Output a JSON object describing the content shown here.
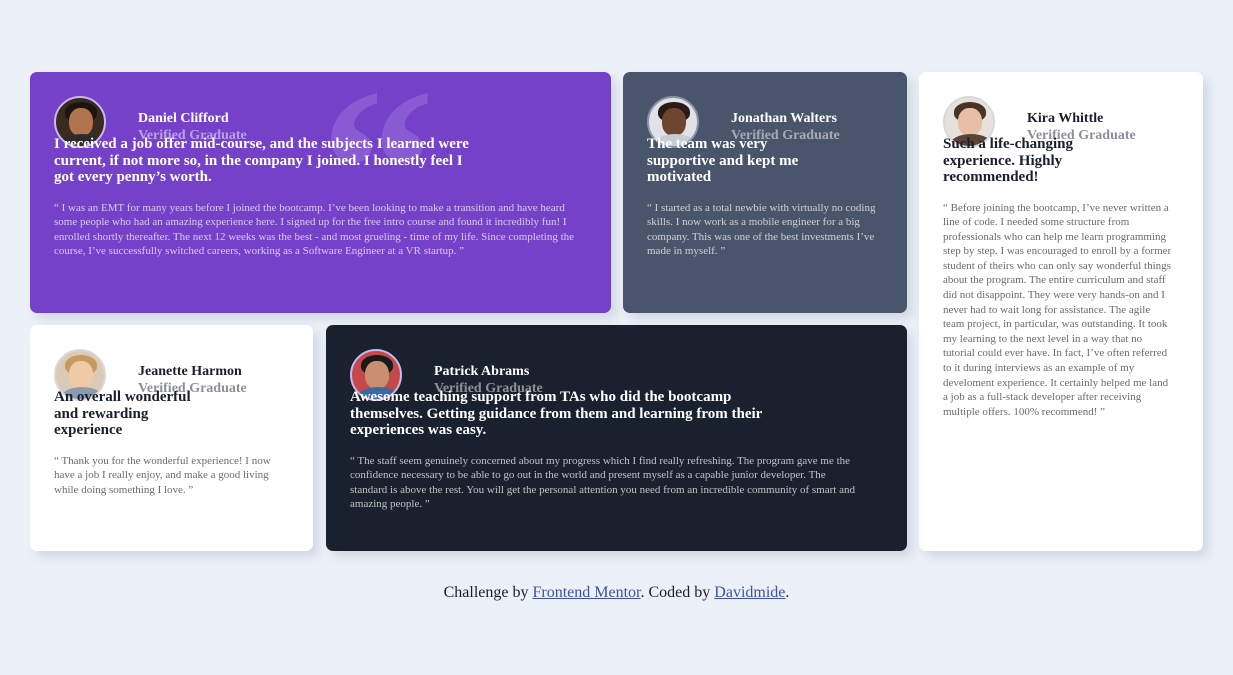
{
  "testimonials": [
    {
      "name": "Daniel Clifford",
      "role": "Verified Graduate",
      "headline": "I received a job offer mid-course, and the subjects I learned were current, if not more so, in the company I joined. I honestly feel I got every penny’s worth.",
      "body": "“ I was an EMT for many years before I joined the bootcamp. I’ve been looking to make a transition and have heard some people who had an amazing experience here. I signed up for the free intro course and found it incredibly fun! I enrolled shortly thereafter. The next 12 weeks was the best - and most grueling - time of my life. Since completing the course, I’ve successfully switched careers, working as a Software Engineer at a VR startup. ”",
      "background": "#7541c8"
    },
    {
      "name": "Jonathan Walters",
      "role": "Verified Graduate",
      "headline": "The team was very supportive and kept me motivated",
      "body": "“ I started as a total newbie with virtually no coding skills. I now work as a mobile engineer for a big company. This was one of the best investments I’ve made in myself. ”",
      "background": "#48556a"
    },
    {
      "name": "Kira Whittle",
      "role": "Verified Graduate",
      "headline": "Such a life-changing experience. Highly recommended!",
      "body": "“ Before joining the bootcamp, I’ve never written a line of code. I needed some structure from professionals who can help me learn programming step by step. I was encouraged to enroll by a former student of theirs who can only say wonderful things about the program. The entire curriculum and staff did not disappoint. They were very hands-on and I never had to wait long for assistance. The agile team project, in particular, was outstanding. It took my learning to the next level in a way that no tutorial could ever have. In fact, I’ve often referred to it during interviews as an example of my develoment experience. It certainly helped me land a job as a full-stack developer after receiving multiple offers. 100% recommend! ”",
      "background": "#ffffff"
    },
    {
      "name": "Jeanette Harmon",
      "role": "Verified Graduate",
      "headline": "An overall wonderful and rewarding experience",
      "body": "“ Thank you for the wonderful experience! I now have a job I really enjoy, and make a good living while doing something I love. ”",
      "background": "#ffffff"
    },
    {
      "name": "Patrick Abrams",
      "role": "Verified Graduate",
      "headline": "Awesome teaching support from TAs who did the bootcamp themselves. Getting guidance from them and learning from their experiences was easy.",
      "body": "“ The staff seem genuinely concerned about my progress which I find really refreshing. The program gave me the confidence necessary to be able to go out in the world and present myself as a capable junior developer. The standard is above the rest. You will get the personal attention you need from an incredible community of smart and amazing people. ”",
      "background": "#19212e"
    }
  ],
  "footer": {
    "prefix": "Challenge by ",
    "link1": "Frontend Mentor",
    "middle": ". Coded by ",
    "link2": "Davidmide",
    "suffix": "."
  }
}
